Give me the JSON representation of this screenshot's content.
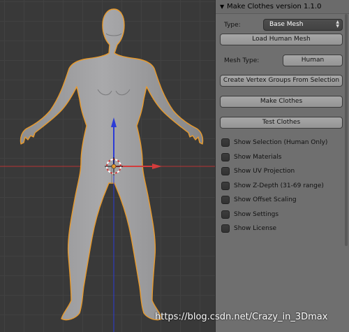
{
  "panel": {
    "title": "Make Clothes version 1.1.0",
    "type_label": "Type:",
    "type_value": "Base Mesh",
    "load_human_mesh": "Load Human Mesh",
    "mesh_type_label": "Mesh Type:",
    "mesh_type_value": "Human",
    "create_vertex_groups": "Create Vertex Groups From Selection",
    "make_clothes": "Make Clothes",
    "test_clothes": "Test Clothes",
    "options": [
      {
        "label": "Show Selection (Human Only)",
        "checked": false
      },
      {
        "label": "Show Materials",
        "checked": false
      },
      {
        "label": "Show UV Projection",
        "checked": false
      },
      {
        "label": "Show Z-Depth (31-69 range)",
        "checked": false
      },
      {
        "label": "Show Offset Scaling",
        "checked": false
      },
      {
        "label": "Show Settings",
        "checked": false
      },
      {
        "label": "Show License",
        "checked": false
      }
    ]
  },
  "watermark": "https://blog.csdn.net/Crazy_in_3Dmax",
  "colors": {
    "axis_x": "#d23c3c",
    "axis_z": "#2c3cd6",
    "outline": "#e89a2c"
  }
}
